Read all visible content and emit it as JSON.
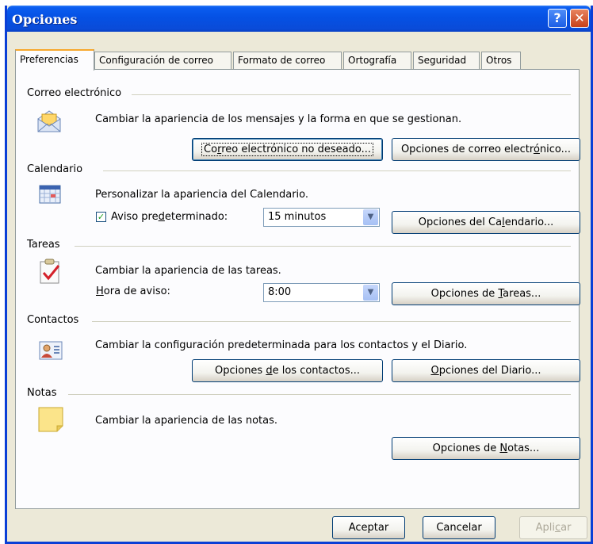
{
  "window": {
    "title": "Opciones",
    "help_glyph": "?",
    "close_glyph": "✕"
  },
  "tabs": [
    {
      "label": "Preferencias",
      "active": true
    },
    {
      "label": "Configuración de correo"
    },
    {
      "label": "Formato de correo"
    },
    {
      "label": "Ortografía"
    },
    {
      "label": "Seguridad"
    },
    {
      "label": "Otros"
    }
  ],
  "email": {
    "title": "Correo electrónico",
    "description": "Cambiar la apariencia de los mensajes y la forma en que se gestionan.",
    "junk_button": {
      "pre": "Co",
      "key": "r",
      "post": "reo electrónico no deseado..."
    },
    "options_button": {
      "pre": "Opciones de correo electr",
      "key": "ó",
      "post": "nico..."
    }
  },
  "calendar": {
    "title": "Calendario",
    "description": "Personalizar la apariencia del Calendario.",
    "reminder_checked": true,
    "reminder_label": {
      "pre": "Aviso pre",
      "key": "d",
      "post": "eterminado:"
    },
    "reminder_value": "15 minutos",
    "options_button": {
      "pre": "Opciones del Ca",
      "key": "l",
      "post": "endario..."
    }
  },
  "tasks": {
    "title": "Tareas",
    "description": "Cambiar la apariencia de las tareas.",
    "reminder_label": {
      "pre": "",
      "key": "H",
      "post": "ora de aviso:"
    },
    "reminder_value": "8:00",
    "options_button": {
      "pre": "Opciones de ",
      "key": "T",
      "post": "areas..."
    }
  },
  "contacts": {
    "title": "Contactos",
    "description": "Cambiar la configuración predeterminada para los contactos y el Diario.",
    "contacts_button": {
      "pre": "Opciones ",
      "key": "d",
      "post": "e los contactos..."
    },
    "journal_button": {
      "pre": "",
      "key": "O",
      "post": "pciones del Diario..."
    }
  },
  "notes": {
    "title": "Notas",
    "description": "Cambiar la apariencia de las notas.",
    "options_button": {
      "pre": "Opciones de ",
      "key": "N",
      "post": "otas..."
    }
  },
  "footer": {
    "ok": "Aceptar",
    "cancel": "Cancelar",
    "apply": {
      "pre": "Apli",
      "key": "c",
      "post": "ar"
    }
  },
  "colors": {
    "titlebar": "#0551e4",
    "dialog_bg": "#ece9d8",
    "tab_highlight": "#f7a82d"
  }
}
